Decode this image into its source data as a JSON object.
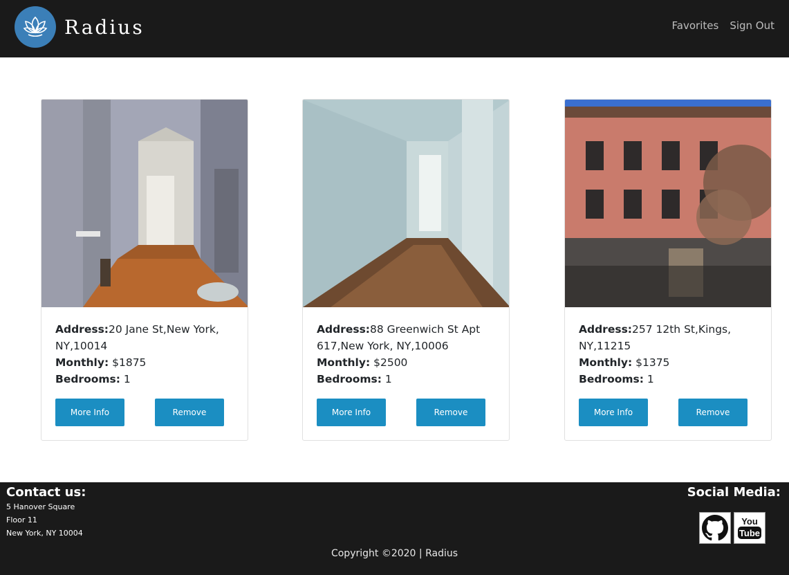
{
  "brand": {
    "name": "Radius",
    "logo_icon": "lotus-icon",
    "logo_color": "#3b7fb8"
  },
  "nav": {
    "favorites": "Favorites",
    "sign_out": "Sign Out"
  },
  "labels": {
    "address": "Address:",
    "monthly": "Monthly:",
    "bedrooms": "Bedrooms:"
  },
  "listings": [
    {
      "address": "20 Jane St,New York, NY,10014",
      "monthly": "$1875",
      "bedrooms": "1",
      "more_info": "More Info",
      "remove": "Remove"
    },
    {
      "address": "88 Greenwich St Apt 617,New York, NY,10006",
      "monthly": "$2500",
      "bedrooms": "1",
      "more_info": "More Info",
      "remove": "Remove"
    },
    {
      "address": "257 12th St,Kings, NY,11215",
      "monthly": "$1375",
      "bedrooms": "1",
      "more_info": "More Info",
      "remove": "Remove"
    }
  ],
  "footer": {
    "contact_title": "Contact us:",
    "address_lines": [
      "5 Hanover Square",
      "Floor 11",
      "New York, NY 10004"
    ],
    "social_title": "Social Media:",
    "social_icons": [
      "github-icon",
      "youtube-icon"
    ],
    "copyright": "Copyright ©2020 | Radius"
  },
  "colors": {
    "navbar": "#1a1a1a",
    "button": "#1b8ec2",
    "footer": "#1a1a1a"
  }
}
